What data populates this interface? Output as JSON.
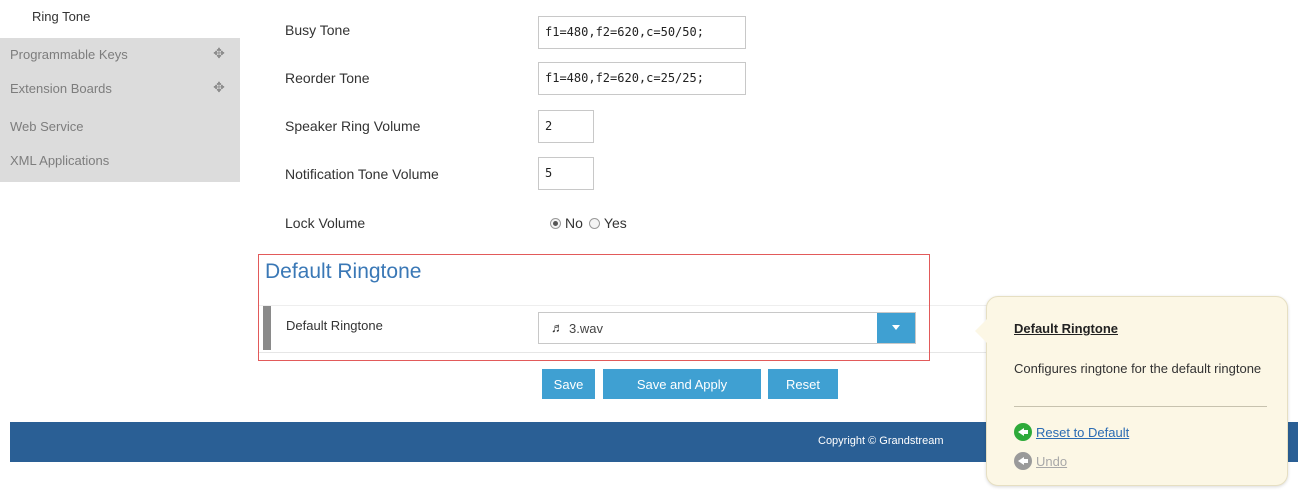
{
  "sidebar": {
    "active": "Ring Tone",
    "items": [
      {
        "label": "Programmable Keys",
        "expandable": true
      },
      {
        "label": "Extension Boards",
        "expandable": true
      },
      {
        "label": "Web Service",
        "expandable": false
      },
      {
        "label": "XML Applications",
        "expandable": false
      }
    ],
    "expand_glyph": "✥"
  },
  "form": {
    "busy_tone": {
      "label": "Busy Tone",
      "value": "f1=480,f2=620,c=50/50;"
    },
    "reorder_tone": {
      "label": "Reorder Tone",
      "value": "f1=480,f2=620,c=25/25;"
    },
    "speaker_ring_volume": {
      "label": "Speaker Ring Volume",
      "value": "2"
    },
    "notification_tone_volume": {
      "label": "Notification Tone Volume",
      "value": "5"
    },
    "lock_volume": {
      "label": "Lock Volume",
      "options": [
        "No",
        "Yes"
      ],
      "selected": "No"
    }
  },
  "default_ringtone_section": {
    "title": "Default Ringtone",
    "field_label": "Default Ringtone",
    "selected_value": "3.wav",
    "note_glyph": "♬"
  },
  "buttons": {
    "save": "Save",
    "save_and_apply": "Save and Apply",
    "reset": "Reset"
  },
  "footer": {
    "text": "Copyright © Grandstream"
  },
  "tooltip": {
    "title": "Default Ringtone",
    "description": "Configures ringtone for the default ringtone",
    "reset_link": "Reset to Default",
    "undo_link": "Undo"
  },
  "colors": {
    "accent": "#3fa0d2",
    "section_title": "#3a78b6",
    "highlight_border": "#e25a5a",
    "footer": "#2a5f95",
    "tooltip_bg": "#fcf7e5",
    "reset_icon": "#2eaa3a"
  }
}
